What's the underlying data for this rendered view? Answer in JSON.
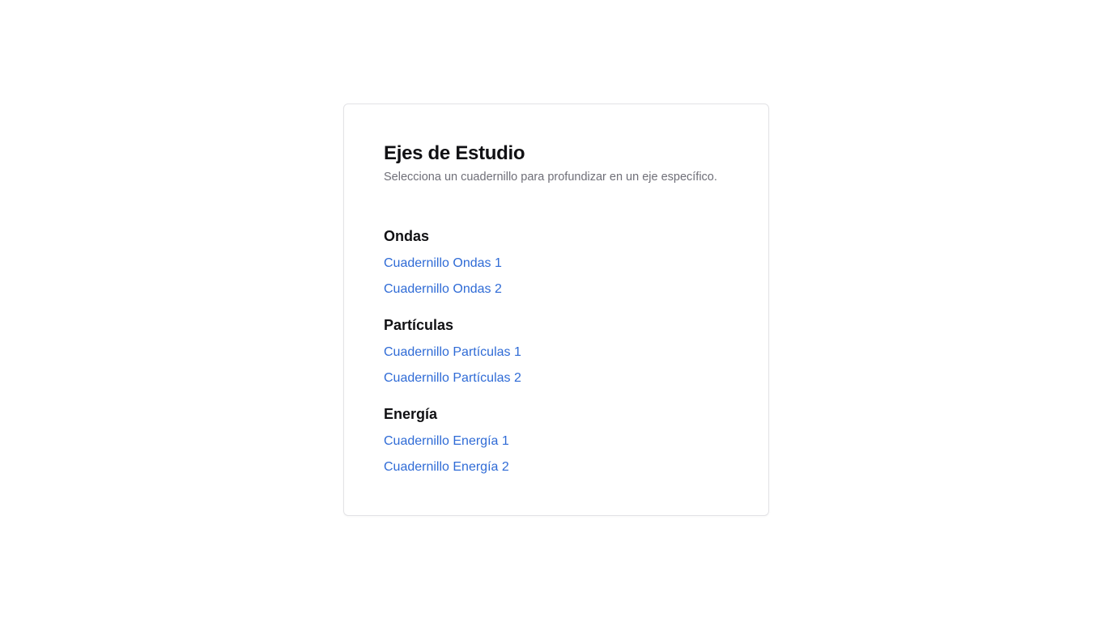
{
  "card": {
    "title": "Ejes de Estudio",
    "subtitle": "Selecciona un cuadernillo para profundizar en un eje específico."
  },
  "sections": [
    {
      "title": "Ondas",
      "links": [
        "Cuadernillo Ondas 1",
        "Cuadernillo Ondas 2"
      ]
    },
    {
      "title": "Partículas",
      "links": [
        "Cuadernillo Partículas 1",
        "Cuadernillo Partículas 2"
      ]
    },
    {
      "title": "Energía",
      "links": [
        "Cuadernillo Energía 1",
        "Cuadernillo Energía 2"
      ]
    }
  ],
  "colors": {
    "link": "#2f6bd6",
    "heading": "#111114",
    "subtitle": "#6f6f78",
    "border": "#e3e3e6"
  }
}
